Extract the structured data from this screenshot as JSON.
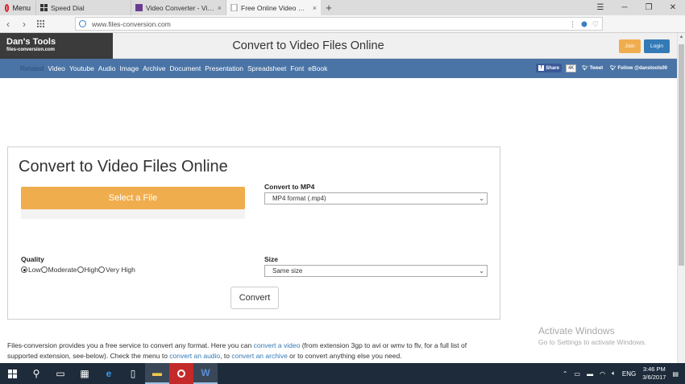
{
  "browser": {
    "menu_label": "Menu",
    "tabs": [
      {
        "title": "Speed Dial",
        "close": ""
      },
      {
        "title": "Video Converter - Video C",
        "close": "×"
      },
      {
        "title": "Free Online Video Convert",
        "close": "×"
      }
    ],
    "new_tab": "+",
    "url": "www.files-conversion.com"
  },
  "site": {
    "logo_line1": "Dan's Tools",
    "logo_line2": "files-conversion.com",
    "header_title": "Convert to Video Files Online",
    "join_label": "Join",
    "login_label": "Login",
    "nav": {
      "related_label": "Related",
      "links": [
        "Video",
        "Youtube",
        "Audio",
        "Image",
        "Archive",
        "Document",
        "Presentation",
        "Spreadsheet",
        "Font",
        "eBook"
      ]
    },
    "social": {
      "share_label": "Share",
      "share_count": "4K",
      "tweet_label": "Tweet",
      "follow_label": "Follow @danstools00"
    }
  },
  "converter": {
    "title": "Convert to Video Files Online",
    "select_file_label": "Select a File",
    "convert_to_label": "Convert to MP4",
    "format_value": "MP4 format (.mp4)",
    "quality_label": "Quality",
    "quality_options": [
      "Low",
      "Moderate",
      "High",
      "Very High"
    ],
    "quality_selected": "Low",
    "size_label": "Size",
    "size_value": "Same size",
    "convert_button": "Convert"
  },
  "description": {
    "part1": "Files-conversion provides you a free service to convert any format. Here you can ",
    "link1": "convert a video",
    "part2": " (from extension 3gp to avi or wmv to flv, for a full list of supported extension, see-below). Check the menu to ",
    "link2": "convert an audio",
    "part3": ", to ",
    "link3": "convert an archive",
    "part4": " or to convert anything else you need."
  },
  "watermark": {
    "line1": "Activate Windows",
    "line2": "Go to Settings to activate Windows."
  },
  "taskbar": {
    "language": "ENG",
    "time": "3:46 PM",
    "date": "3/6/2017"
  },
  "colors": {
    "accent_orange": "#f0ad4e",
    "nav_blue": "#4a74a6",
    "login_blue": "#337ab7"
  }
}
